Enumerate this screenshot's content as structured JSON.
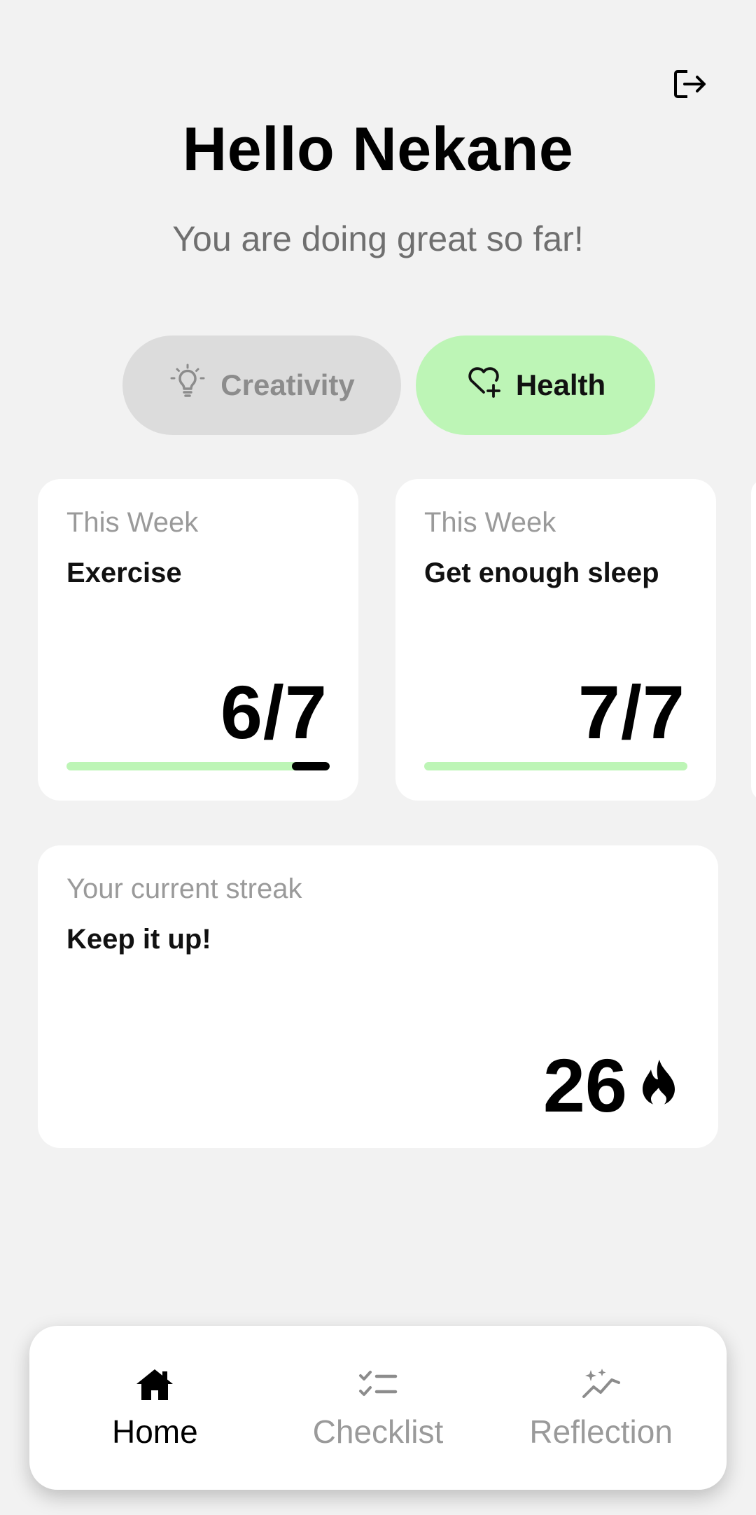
{
  "header": {
    "greeting": "Hello Nekane",
    "subtitle": "You are doing great so far!",
    "logout_icon": "logout-icon"
  },
  "categories": [
    {
      "label": "Creativity",
      "icon": "lightbulb-icon",
      "selected": false
    },
    {
      "label": "Health",
      "icon": "heart-plus-icon",
      "selected": true
    }
  ],
  "habit_cards": [
    {
      "kicker": "This Week",
      "title": "Exercise",
      "score": "6/7",
      "progress": 0.857
    },
    {
      "kicker": "This Week",
      "title": "Get enough sleep",
      "score": "7/7",
      "progress": 1.0
    }
  ],
  "streak": {
    "kicker": "Your current streak",
    "title": "Keep it up!",
    "value": "26",
    "icon": "flame-icon"
  },
  "nav": [
    {
      "label": "Home",
      "icon": "home-icon",
      "active": true
    },
    {
      "label": "Checklist",
      "icon": "checklist-icon",
      "active": false
    },
    {
      "label": "Reflection",
      "icon": "sparkle-chart-icon",
      "active": false
    }
  ],
  "colors": {
    "background": "#f2f2f2",
    "accent_green": "#bdf5b6",
    "chip_inactive": "#dcdcdc",
    "muted_text": "#9a9a9a"
  }
}
